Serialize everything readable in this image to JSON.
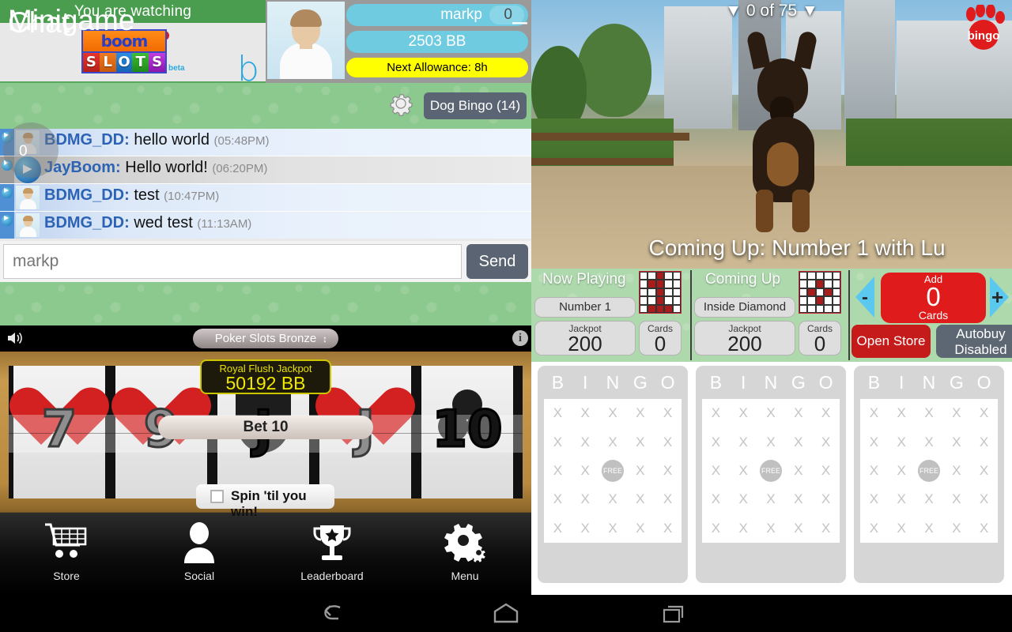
{
  "header": {
    "watching_label": "You are watching",
    "logo": {
      "top": "boom",
      "letters": [
        "S",
        "L",
        "O",
        "T",
        "S"
      ],
      "beta": "beta",
      "partial": "b"
    }
  },
  "profile": {
    "username": "markp",
    "count": "0",
    "balance": "2503 BB",
    "allowance": "Next Allowance: 8h"
  },
  "chat": {
    "title": "Chat",
    "gear_icon": "gear-icon",
    "room_button": "Dog Bingo (14)",
    "overlay_badge": "0",
    "messages": [
      {
        "user": "BDMG_DD:",
        "body": "hello world",
        "time": "(05:48PM)"
      },
      {
        "user": "JayBoom:",
        "body": "Hello world!",
        "time": "(06:20PM)"
      },
      {
        "user": "BDMG_DD:",
        "body": "test",
        "time": "(10:47PM)"
      },
      {
        "user": "BDMG_DD:",
        "body": "wed test",
        "time": "(11:13AM)"
      }
    ],
    "input_value": "markp",
    "input_placeholder": "markp",
    "send_label": "Send"
  },
  "minigame": {
    "title": "Minigame",
    "minimize": "–",
    "speaker_icon": "speaker-icon",
    "game_name": "Poker Slots Bronze",
    "select_arrows": "↕",
    "info_icon": "info-icon",
    "jackpot_label": "Royal Flush Jackpot",
    "jackpot_value": "50192 BB",
    "bet_label": "Bet 10",
    "spin_checkbox_label": "Spin 'til you win!",
    "spin_checked": false,
    "reels": [
      {
        "rank": "7",
        "suit": "heart"
      },
      {
        "rank": "9",
        "suit": "heart"
      },
      {
        "rank": "J",
        "suit": "spade"
      },
      {
        "rank": "J",
        "suit": "heart"
      },
      {
        "rank": "10",
        "suit": "club"
      }
    ]
  },
  "tabs": [
    {
      "label": "Store",
      "icon": "cart-icon"
    },
    {
      "label": "Social",
      "icon": "person-icon"
    },
    {
      "label": "Leaderboard",
      "icon": "trophy-icon"
    },
    {
      "label": "Menu",
      "icon": "gear-icon"
    }
  ],
  "video": {
    "ball_count": "▼ 0 of 75 ▼",
    "logo_text": "bingo",
    "caption": "Coming Up: Number 1 with Lu"
  },
  "bingo_controls": {
    "now_playing": {
      "title": "Now Playing",
      "pattern_name": "Number 1",
      "jackpot_label": "Jackpot",
      "jackpot_value": "200",
      "cards_label": "Cards",
      "cards_value": "0",
      "pattern_grid": [
        [
          0,
          0,
          1,
          0,
          0
        ],
        [
          0,
          1,
          1,
          0,
          0
        ],
        [
          0,
          0,
          1,
          0,
          0
        ],
        [
          0,
          0,
          1,
          0,
          0
        ],
        [
          0,
          1,
          1,
          1,
          0
        ]
      ]
    },
    "coming_up": {
      "title": "Coming Up",
      "pattern_name": "Inside Diamond",
      "jackpot_label": "Jackpot",
      "jackpot_value": "200",
      "cards_label": "Cards",
      "cards_value": "0",
      "pattern_grid": [
        [
          0,
          0,
          0,
          0,
          0
        ],
        [
          0,
          0,
          1,
          0,
          0
        ],
        [
          0,
          1,
          0,
          1,
          0
        ],
        [
          0,
          0,
          1,
          0,
          0
        ],
        [
          0,
          0,
          0,
          0,
          0
        ]
      ]
    },
    "decrement": "-",
    "increment": "+",
    "add_label": "Add",
    "add_value": "0",
    "cards_word": "Cards",
    "open_store": "Open Store",
    "autobuy_line1": "Autobuy",
    "autobuy_line2": "Disabled"
  },
  "bingo_cards": {
    "columns": [
      "B",
      "I",
      "N",
      "G",
      "O"
    ],
    "cell_mark": "X",
    "free_label": "FREE",
    "cards": [
      {
        "id": "card-1"
      },
      {
        "id": "card-2"
      },
      {
        "id": "card-3"
      }
    ]
  },
  "android_nav": {
    "back": "back-icon",
    "home": "home-icon",
    "recents": "recents-icon"
  },
  "colors": {
    "green_header": "#8cc98f",
    "watch_green": "#4a9d4f",
    "pill_blue": "#6fcbe0",
    "allowance_yellow": "#ffff00",
    "accent_red": "#e01b1b",
    "slate": "#5a6472",
    "cyan_arrow": "#5bc8f0"
  }
}
